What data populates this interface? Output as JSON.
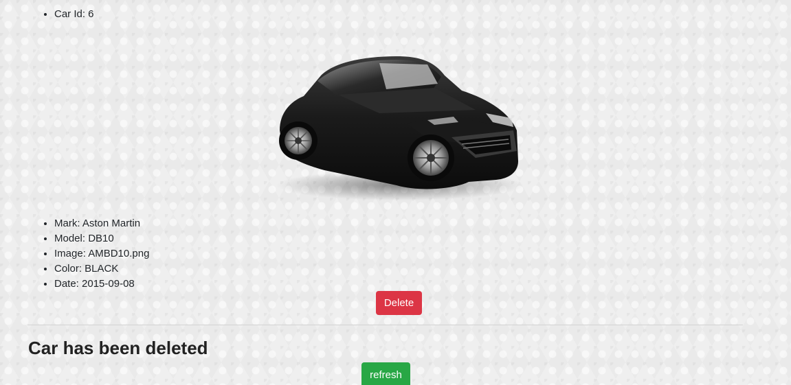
{
  "car": {
    "id_text": "Car Id: 6",
    "mark_text": "Mark: Aston Martin",
    "model_text": "Model: DB10",
    "image_text": "Image: AMBD10.png",
    "color_text": "Color: BLACK",
    "date_text": "Date: 2015-09-08",
    "image_alt": "AMBD10.png"
  },
  "actions": {
    "delete_label": "Delete",
    "refresh_label": "refresh"
  },
  "status": {
    "message": "Car has been deleted"
  },
  "colors": {
    "delete": "#dc3545",
    "refresh": "#28a745"
  }
}
